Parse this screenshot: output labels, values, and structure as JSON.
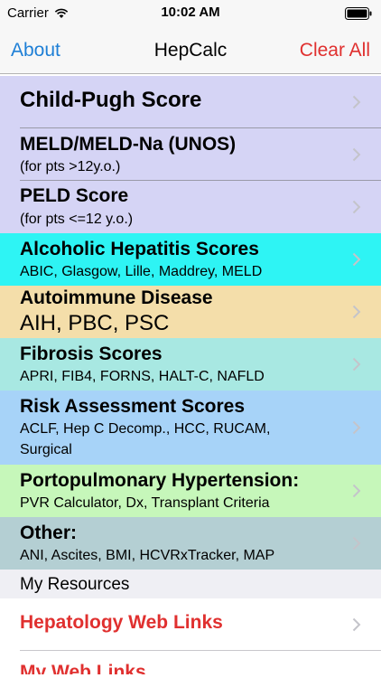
{
  "status_bar": {
    "carrier": "Carrier",
    "time": "10:02 AM"
  },
  "nav": {
    "left": "About",
    "title": "HepCalc",
    "right": "Clear All"
  },
  "colors": {
    "accent_blue": "#1e7fd6",
    "accent_red": "#e0302f",
    "lavender": "#d5d4f5",
    "cyan": "#2ef4f4",
    "tan": "#f4deaa",
    "teal": "#a8e8e2",
    "sky": "#a7d3f8",
    "mint": "#c6f7ba",
    "slate": "#b4cfd3"
  },
  "rows": [
    {
      "title": "Child-Pugh Score",
      "sub": ""
    },
    {
      "title": "MELD/MELD-Na  (UNOS)",
      "sub": "(for pts >12y.o.)"
    },
    {
      "title": "PELD Score",
      "sub": "(for pts <=12 y.o.)"
    },
    {
      "title": "Alcoholic Hepatitis Scores",
      "sub": "ABIC, Glasgow, Lille, Maddrey, MELD"
    },
    {
      "title": "Autoimmune Disease",
      "sub": "AIH, PBC, PSC"
    },
    {
      "title": "Fibrosis Scores",
      "sub": "APRI, FIB4, FORNS, HALT-C, NAFLD"
    },
    {
      "title": "Risk Assessment Scores",
      "sub": "ACLF, Hep C Decomp., HCC, RUCAM,",
      "sub2": "Surgical"
    },
    {
      "title": "Portopulmonary Hypertension:",
      "sub": "PVR Calculator, Dx, Transplant Criteria"
    },
    {
      "title": "Other:",
      "sub": "ANI, Ascites, BMI, HCVRxTracker, MAP"
    }
  ],
  "resources": {
    "header": "My Resources",
    "items": [
      {
        "title": "Hepatology Web Links"
      },
      {
        "title": "My Web Links"
      }
    ]
  }
}
